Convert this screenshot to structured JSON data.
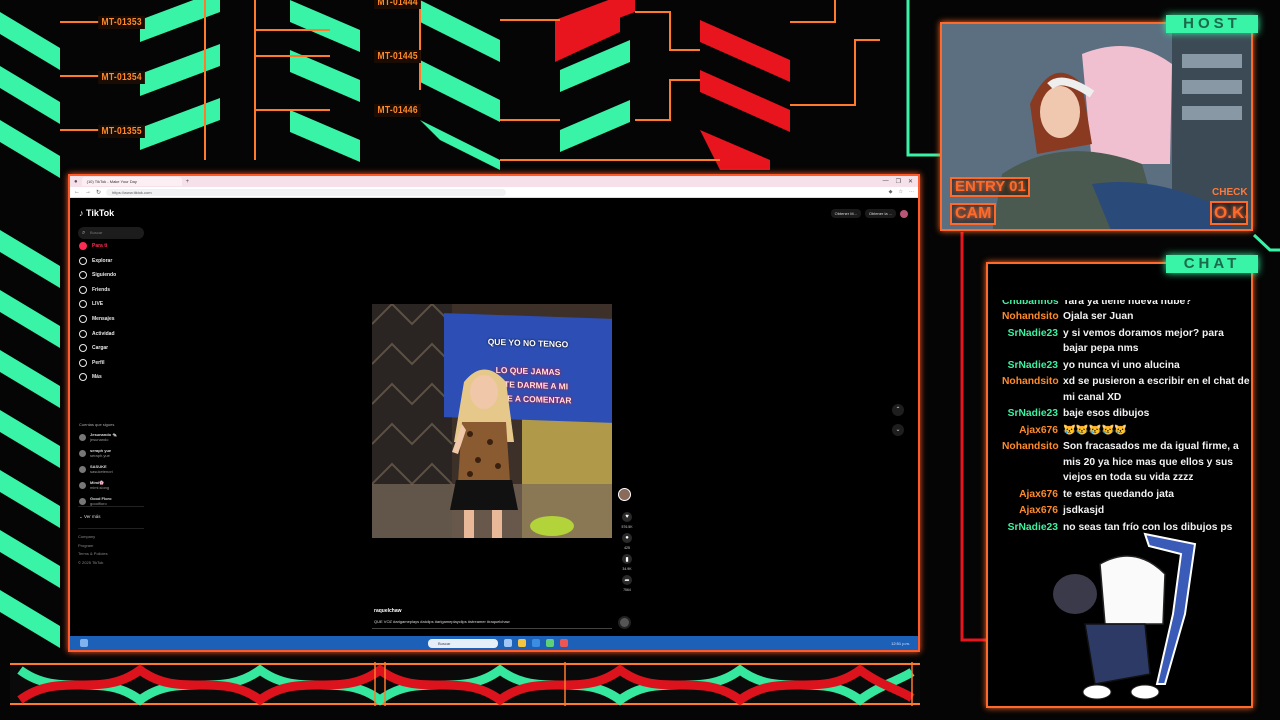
{
  "overlay": {
    "bracket_labels": [
      "MT-01353",
      "MT-01354",
      "MT-01355",
      "MT-01444",
      "MT-01445",
      "MT-01446"
    ],
    "colors": {
      "green": "#39f3a6",
      "red": "#e8141e",
      "orange": "#ff6a2a"
    }
  },
  "browser": {
    "tab_title": "(10) TikTok - Make Your Day",
    "url": "https://www.tiktok.com",
    "window_controls": [
      "—",
      "❐",
      "✕"
    ]
  },
  "tiktok": {
    "logo": "TikTok",
    "search_placeholder": "Buscar",
    "nav": [
      {
        "label": "Para ti",
        "icon": "home-icon",
        "active": true
      },
      {
        "label": "Explorar",
        "icon": "compass-icon"
      },
      {
        "label": "Siguiendo",
        "icon": "following-icon"
      },
      {
        "label": "Friends",
        "icon": "friends-icon"
      },
      {
        "label": "LIVE",
        "icon": "live-icon"
      },
      {
        "label": "Mensajes",
        "icon": "messages-icon"
      },
      {
        "label": "Actividad",
        "icon": "activity-icon"
      },
      {
        "label": "Cargar",
        "icon": "upload-icon"
      },
      {
        "label": "Perfil",
        "icon": "profile-icon"
      },
      {
        "label": "Más",
        "icon": "more-icon"
      }
    ],
    "following_title": "Cuentas que sigues",
    "following": [
      {
        "name": "Jesunando 🐀",
        "handle": "jesunando"
      },
      {
        "name": "seraph yue",
        "handle": "seraph.yue"
      },
      {
        "name": "SASUKE",
        "handle": "sasuketenori"
      },
      {
        "name": "Mimi🌸",
        "handle": "mimi.slong"
      },
      {
        "name": "Good Floro",
        "handle": "goodfloro"
      }
    ],
    "see_more": "Ver más",
    "footer_links": [
      "Company",
      "Program",
      "Terms & Policies",
      "© 2025 TikTok"
    ],
    "top_actions": [
      "Obtener M...",
      "Obtener la ..."
    ],
    "video": {
      "lyrics": [
        "QUE YO NO TENGO",
        "LO QUE JAMAS",
        "ISISTE DARME A MI",
        "TREVE A COMENTAR"
      ],
      "username": "raquelchaw",
      "caption": "QUE VOZ #arigameplays #aiclips #arigameplayclips #streamer #raquelchaw",
      "counts": {
        "likes": "576.5K",
        "comments": "425",
        "saves": "34.9K",
        "shares": "7564"
      }
    }
  },
  "taskbar": {
    "search_placeholder": "Buscar",
    "time": "12:51 p.m."
  },
  "host": {
    "label": "HOST",
    "entry": "ENTRY 01",
    "cam": "CAM",
    "check": "CHECK",
    "ok": "O.K."
  },
  "chat": {
    "label": "CHAT",
    "messages": [
      {
        "user": "Chubannos",
        "text": "Tara ya tiene nueva nube?",
        "color": "#3ef0a0"
      },
      {
        "user": "Nohandsito",
        "text": "Ojala ser Juan",
        "color": "#ff8a2a"
      },
      {
        "user": "SrNadie23",
        "text": "y si vemos doramos mejor? para bajar pepa nms",
        "color": "#3ef0a0"
      },
      {
        "user": "SrNadie23",
        "text": "yo nunca vi uno alucina",
        "color": "#3ef0a0"
      },
      {
        "user": "Nohandsito",
        "text": "xd se pusieron a escribir en el chat de mi canal XD",
        "color": "#ff8a2a"
      },
      {
        "user": "SrNadie23",
        "text": "baje esos dibujos",
        "color": "#3ef0a0"
      },
      {
        "user": "Ajax676",
        "text": "😿😿😿😿😿",
        "color": "#ff8a2a"
      },
      {
        "user": "Nohandsito",
        "text": "Son fracasados me da igual firme, a mis 20 ya hice mas que ellos y sus viejos en toda su vida zzzz",
        "color": "#ff8a2a"
      },
      {
        "user": "Ajax676",
        "text": "te estas quedando jata",
        "color": "#ff8a2a"
      },
      {
        "user": "Ajax676",
        "text": "jsdkasjd",
        "color": "#ff8a2a"
      },
      {
        "user": "SrNadie23",
        "text": "no seas tan frío con los dibujos ps",
        "color": "#3ef0a0"
      }
    ]
  }
}
